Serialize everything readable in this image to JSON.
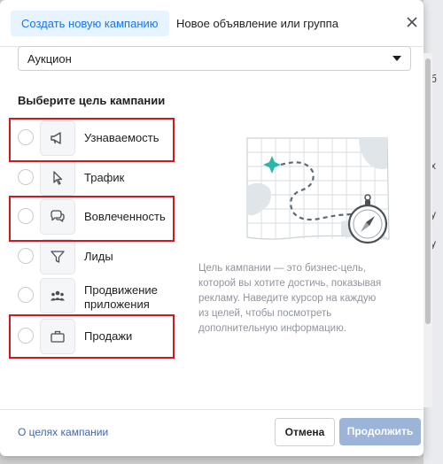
{
  "tabs": {
    "active_label": "Создать новую кампанию",
    "other_label": "Новое объявление или группа"
  },
  "close_icon": "close-icon",
  "buying_type": {
    "value": "Аукцион"
  },
  "section_title": "Выберите цель кампании",
  "objectives": [
    {
      "label": "Узнаваемость",
      "icon": "megaphone-icon",
      "selected": false,
      "highlighted": true
    },
    {
      "label": "Трафик",
      "icon": "cursor-icon",
      "selected": false,
      "highlighted": false
    },
    {
      "label": "Вовлеченность",
      "icon": "chat-bubble-icon",
      "selected": false,
      "highlighted": true
    },
    {
      "label": "Лиды",
      "icon": "funnel-icon",
      "selected": false,
      "highlighted": false
    },
    {
      "label_line1": "Продвижение",
      "label_line2": "приложения",
      "icon": "people-icon",
      "selected": false,
      "highlighted": false
    },
    {
      "label": "Продажи",
      "icon": "briefcase-icon",
      "selected": false,
      "highlighted": true
    }
  ],
  "illustration": {
    "icons": [
      "map-icon",
      "compass-icon"
    ]
  },
  "description_lines": [
    "Цель кампании — это бизнес-цель,",
    "которой вы хотите достичь, показывая",
    "рекламу. Наведите курсор на каждую",
    "из целей, чтобы посмотреть",
    "дополнительную информацию."
  ],
  "footer": {
    "link": "О целях кампании",
    "cancel": "Отмена",
    "continue": "Продолжить"
  },
  "colors": {
    "accent": "#1877f2",
    "tab_bg": "#e7f3ff",
    "highlight": "#d0191e",
    "disabled_button": "#9cb4d8"
  }
}
